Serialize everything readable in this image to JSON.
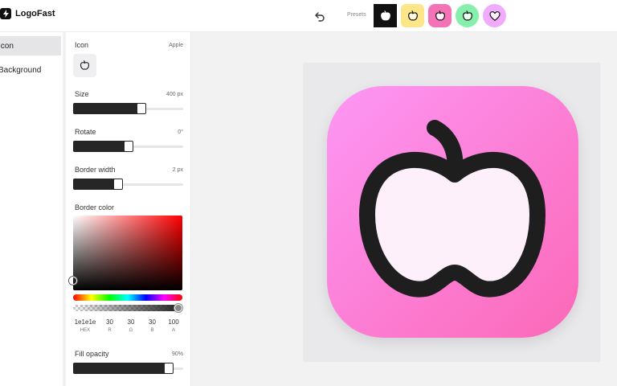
{
  "app": {
    "name": "LogoFast"
  },
  "header": {
    "presets_label": "Presets"
  },
  "nav": {
    "items": [
      {
        "label": "Icon"
      },
      {
        "label": "Background"
      }
    ]
  },
  "panel": {
    "icon": {
      "label": "Icon",
      "value": "Apple"
    },
    "size": {
      "label": "Size",
      "value": "400 px",
      "level": 0.63
    },
    "rotate": {
      "label": "Rotate",
      "value": "0°",
      "level": 0.5
    },
    "border_width": {
      "label": "Border width",
      "value": "2 px",
      "level": 0.4
    },
    "border_color": {
      "label": "Border color",
      "hex": "1e1e1e",
      "r": "30",
      "g": "30",
      "b": "30",
      "a": "100",
      "labels": {
        "hex": "HEX",
        "r": "R",
        "g": "G",
        "b": "B",
        "a": "A"
      }
    },
    "fill_opacity": {
      "label": "Fill opacity",
      "value": "90%",
      "level": 0.9
    }
  },
  "colors": {
    "border": "#1e1e1e",
    "preset_backgrounds": [
      "#111111",
      "#fde68a",
      "#f472b6",
      "#86efac",
      "#f0abfc"
    ],
    "icon_gradient_start": "#fd97f5",
    "icon_gradient_end": "#fc68b7",
    "apple_fill": "#fdf0fb"
  },
  "icons": [
    "bolt-icon",
    "undo-icon",
    "apple-icon",
    "heart-icon"
  ]
}
